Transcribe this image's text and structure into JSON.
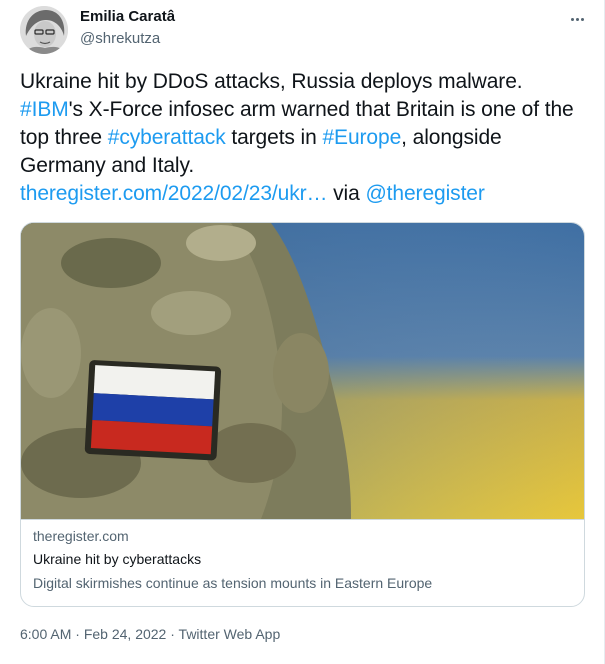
{
  "author": {
    "name": "Emilia Caratâ",
    "handle": "@shrekutza"
  },
  "tweet": {
    "line1": "Ukraine hit by DDoS attacks, Russia deploys malware.",
    "tag_ibm": "#IBM",
    "text_a": "'s X-Force infosec arm warned  that Britain is one of the top three ",
    "tag_cyber": "#cyberattack",
    "text_b": " targets in ",
    "tag_europe": "#Europe",
    "text_c": ", alongside Germany and Italy.",
    "link": "theregister.com/2022/02/23/ukr…",
    "via": " via ",
    "mention": "@theregister"
  },
  "card": {
    "domain": "theregister.com",
    "title": "Ukraine hit by cyberattacks",
    "description": "Digital skirmishes continue as tension mounts in Eastern Europe"
  },
  "meta": {
    "time": "6:00 AM",
    "sep1": " · ",
    "date": "Feb 24, 2022",
    "sep2": " · ",
    "source": "Twitter Web App"
  },
  "colors": {
    "link": "#1d9bf0",
    "text": "#0f1419",
    "muted": "#536471",
    "border": "#cfd9de"
  },
  "icons": {
    "more": "more-horizontal-icon"
  }
}
